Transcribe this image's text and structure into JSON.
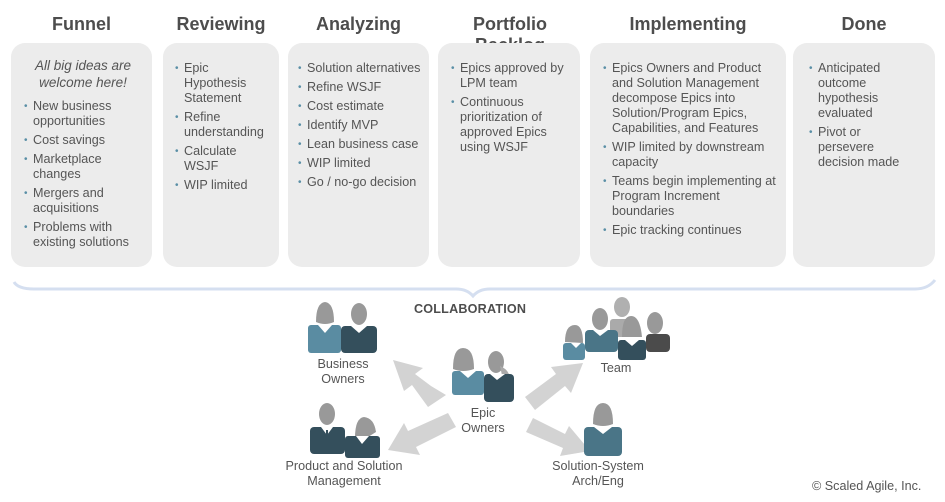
{
  "columns": [
    {
      "title": "Funnel",
      "intro": "All big ideas are welcome here!",
      "items": [
        "New business opportunities",
        "Cost savings",
        "Marketplace changes",
        "Mergers and acquisitions",
        "Problems with existing solutions"
      ]
    },
    {
      "title": "Reviewing",
      "items": [
        "Epic Hypothesis Statement",
        "Refine understanding",
        "Calculate WSJF",
        "WIP limited"
      ]
    },
    {
      "title": "Analyzing",
      "items": [
        "Solution alternatives",
        "Refine WSJF",
        "Cost estimate",
        "Identify MVP",
        "Lean business case",
        "WIP limited",
        "Go / no-go decision"
      ]
    },
    {
      "title": "Portfolio Backlog",
      "items": [
        "Epics approved by LPM team",
        "Continuous prioritization of approved Epics using WSJF"
      ]
    },
    {
      "title": "Implementing",
      "items": [
        "Epics Owners and Product and Solution Management decompose Epics into Solution/Program Epics, Capabilities, and Features",
        "WIP limited by downstream capacity",
        "Teams begin implementing at Program Increment boundaries",
        "Epic tracking continues"
      ]
    },
    {
      "title": "Done",
      "items": [
        "Anticipated outcome hypothesis evaluated",
        "Pivot or persevere decision made"
      ]
    }
  ],
  "collaboration": {
    "title": "COLLABORATION",
    "roles": {
      "business_owners": "Business Owners",
      "product_solution_mgmt": "Product and Solution Management",
      "epic_owners": "Epic Owners",
      "team": "Team",
      "solution_arch": "Solution-System Arch/Eng"
    }
  },
  "colors": {
    "card_bg": "#ececec",
    "brace": "#d5dff0",
    "arrow": "#d3d3d3",
    "head": "#999999",
    "blue_light": "#5a8ca2",
    "blue_mid": "#4a7587",
    "blue_dark": "#344f5c",
    "dark_gray": "#4b4b4b"
  },
  "copyright": "© Scaled Agile, Inc."
}
